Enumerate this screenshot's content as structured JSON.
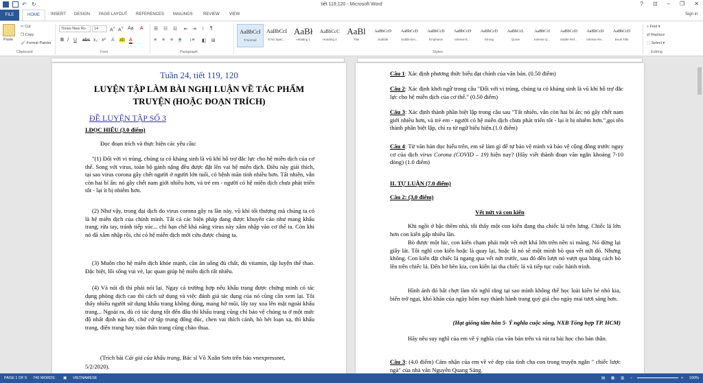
{
  "window": {
    "title": "tiết 119,120 - Microsoft Word",
    "controls": [
      "?",
      "⊡",
      "–",
      "❐",
      "✕"
    ],
    "sign_in": "Sign in"
  },
  "ribbon_tabs": {
    "file": "FILE",
    "items": [
      "HOME",
      "INSERT",
      "DESIGN",
      "PAGE LAYOUT",
      "REFERENCES",
      "MAILINGS",
      "REVIEW",
      "VIEW"
    ]
  },
  "clipboard": {
    "paste": "Paste",
    "cut": "Cut",
    "copy": "Copy",
    "format_painter": "Format Painter",
    "label": "Clipboard"
  },
  "font": {
    "name": "Times New Ro",
    "size": "14",
    "label": "Font"
  },
  "paragraph": {
    "label": "Paragraph"
  },
  "styles": {
    "label": "Styles",
    "items": [
      {
        "sample": "AaBbCcI",
        "name": "¶ Normal",
        "size": 8
      },
      {
        "sample": "AaBbCcI",
        "name": "¶ No Spac...",
        "size": 8
      },
      {
        "sample": "AaBł",
        "name": "Heading 1",
        "size": 13
      },
      {
        "sample": "AaBbCcC",
        "name": "Heading 2",
        "size": 7
      },
      {
        "sample": "AaBl",
        "name": "Title",
        "size": 13
      },
      {
        "sample": "AaBbCcD",
        "name": "Subtitle",
        "size": 6
      },
      {
        "sample": "AaBbCcD",
        "name": "Subtle Em...",
        "size": 6
      },
      {
        "sample": "AaBbCcD",
        "name": "Emphasis",
        "size": 6
      },
      {
        "sample": "AaBbCcD",
        "name": "Intense E...",
        "size": 6
      },
      {
        "sample": "AaBbCcD",
        "name": "Strong",
        "size": 6
      },
      {
        "sample": "AaBbCcL",
        "name": "Quote",
        "size": 6
      },
      {
        "sample": "AaBbCcI",
        "name": "Intense Q...",
        "size": 6
      },
      {
        "sample": "AaBbCcD",
        "name": "Subtle Ref...",
        "size": 6
      },
      {
        "sample": "AaBbCcD",
        "name": "Intense Re...",
        "size": 6
      },
      {
        "sample": "AaBbCcD",
        "name": "Book Title",
        "size": 6
      }
    ]
  },
  "editing": {
    "find": "Find",
    "replace": "Replace",
    "select": "Select",
    "label": "Editing"
  },
  "left_page": {
    "title_line": "Tuần 24, tiết 119, 120",
    "heading1": "LUYỆN TẬP LÀM BÀI NGHỊ LUẬN VỀ TÁC PHẨM",
    "heading2": "TRUYỆN (HOẶC ĐOẠN TRÍCH)",
    "exercise": "ĐỀ LUYỆN TẬP SỐ 3",
    "section1": "I.ĐỌC HIỂU (3.0 điểm)",
    "instruction": "Đọc đoạn trích và thực hiện các yêu cầu:",
    "para1": "\"(1) Đối với vi trùng, chúng ta có kháng sinh là vũ khí hỗ trợ đắc lực cho hệ miễn dịch của cơ thể. Song với virus, toàn bộ gánh nặng đều được đặt lên vai hệ miễn dịch. Điều này giải thích, tại sao virus corona gây chết người ở người lớn tuổi, có bệnh mãn tính nhiều hơn. Tất nhiên, vẫn còn hai bí ẩn: nó gây chết nam giới nhiều hơn, và trẻ em - người có hệ miễn dịch chưa phát triển tốt - lại ít bị nhiễm hơn.",
    "para2": "(2) Như vậy, trong đại dịch do virus corona gây ra lần này, vũ khí tối thượng mà chúng ta có là hệ miễn dịch của chính mình. Tất cả các biện pháp đang được khuyến cáo như mang khẩu trang, rửa tay, tránh tiếp xúc... chỉ hạn chế khả năng virus này xâm nhập vào cơ thể ta. Còn khi nó đã xâm nhập rồi, chỉ có hệ miễn dịch mới cứu được chúng ta.",
    "para3": "(3) Muốn cho hệ miễn dịch khỏe mạnh, cần ăn uống đủ chất, đủ vitamin, tập luyện thể thao. Đặc biệt, lối sống vui vẻ, lạc quan giúp hệ miễn dịch rất nhiều.",
    "para4": "(4) Và nói đi thì phải nói lại. Ngay cả trường hợp nếu khẩu trang được chứng minh có tác dụng phòng dịch cao thì cách sử dụng và việc đánh giá tác dụng của nó cũng cần xem lại. Tôi thấy nhiều người sử dụng khẩu trang không đúng, mang hở mũi, lấy tay xoa lên mặt ngoài khẩu trang... Ngoài ra, dù có tác dụng tốt đến đâu thì khẩu trang cũng chỉ bảo vệ chúng ta ở một mức độ nhất định nào đó, chứ cứ tập trung đông đúc, chen vai thích cánh, hò hét loạn xạ, thì khẩu trang, điện trang hay toàn thân trang cũng chào thua.",
    "citation_pre": "(Trích bài ",
    "citation_italic": "Cái giá của khẩu trang,",
    "citation_post": " Bác sĩ Võ Xuân Sơn trên báo vnexpressnet,",
    "citation_date": "5/2/2020)."
  },
  "right_page": {
    "q1_label": "Câu 1",
    "q1": ": Xác định phương thức biểu đạt chính của văn bản. (0.50 điểm)",
    "q2_label": "Câu 2",
    "q2": ": Xác định khởi ngữ trong câu \"Đối với vi trùng, chúng ta có kháng sinh là vũ khí hỗ trợ đắc lực cho hệ miễn dịch của cơ thể.\" (0.50 điểm)",
    "q3_label": "Câu 3",
    "q3": ": Xác định thành phần biệt lập trong câu sau \"Tất nhiên, vẫn còn hai bí ẩn: nó gây chết nam giới nhiều hơn, và trẻ em - người có hệ miễn dịch chưa phát triển tốt - lại ít bị nhiễm hơn.\",gọi tên thành phần biệt lập, chỉ ra từ ngữ biểu hiện.(1.0 điểm)",
    "q4_label": "Câu 4",
    "q4_pre": ": Từ văn bản đọc hiểu trên, em sẽ làm gì để tự bảo vệ mình và bảo vệ cộng đồng trước nguy cơ của dịch ",
    "q4_italic": "virus Corona (COVID – 19)",
    "q4_post": " hiện nay? (Hãy viết thành đoạn văn ngắn khoảng 7-10 dòng) (1.0 điểm)",
    "section2": "II. TỰ LUẬN (7.0 điểm)",
    "c2_label": "Câu 2: (3,0 điểm)",
    "story_title": "Vết nứt và con kiến",
    "story1": "Khi ngồi ở bậc thềm nhà, tôi thấy một con kiến đang tha chiếc lá trên lưng. Chiếc lá lớn hơn con kiến gấp nhiều lần.",
    "story2": "Bò được một lúc, con kiến chạm phải một vết nứt khá lớn trên nền xi măng. Nó dừng lại giây lát. Tôi nghĩ con kiến hoặc là quay lại, hoặc là nó sẽ một mình bò qua vết nứt đó. Nhưng không. Con kiến đặt chiếc lá ngang qua vết nứt trước, sau đó đến lượt nó vượt qua bằng cách bò lên trên chiếc lá. Đến bờ bên kia, con kiến lại tha chiếc lá và tiếp tục cuộc hành trình.",
    "story3": "Hình ảnh đó bất chợt làm tôi nghĩ rằng tại sao mình không thể học loài kiến bé nhỏ kia, biến trở ngại, khó khăn của ngày hôm nay thành hành trang quý giá cho ngày mai tươi sáng hơn.",
    "source": "(Hạt giống tâm hồn 5- Ý nghĩa cuộc sống, NXB Tổng hợp TP. HCM)",
    "task": "Hãy nêu suy nghĩ của em về ý nghĩa của văn bản trên và rút ra bài học cho bản thân.",
    "c3_label": "Câu 3",
    "c3": ": (4.0 điểm)  Cảm nhận của em về vẻ đẹp của tình cha con trong truyện ngắn \" chiếc lược ngà\" của nhà văn Nguyễn Quang Sáng."
  },
  "status": {
    "page": "PAGE 1 OF 5",
    "words": "740 WORDS",
    "language": "VIETNAMESE",
    "zoom": "100%"
  }
}
